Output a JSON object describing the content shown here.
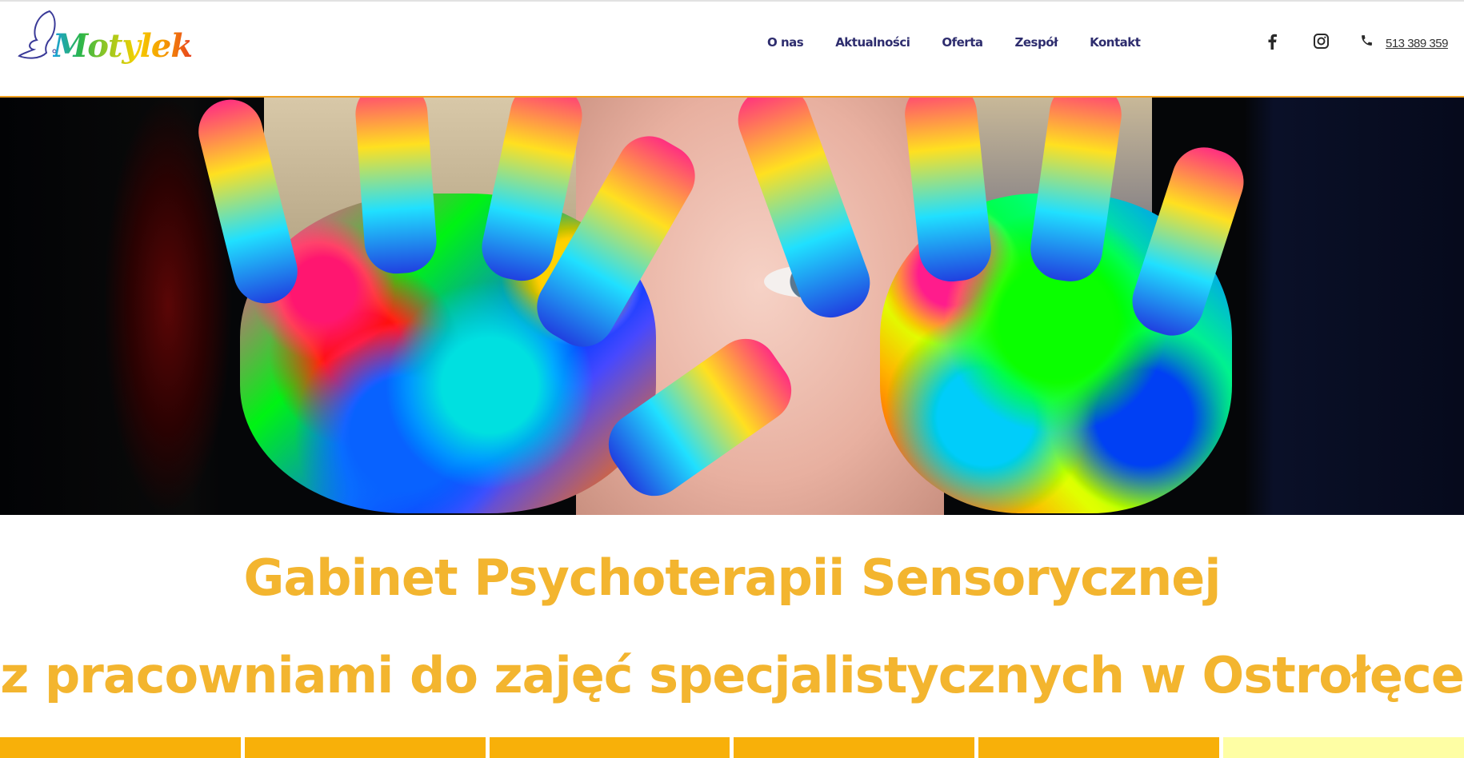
{
  "header": {
    "logo_text": "Motylek",
    "nav": [
      "O nas",
      "Aktualności",
      "Oferta",
      "Zespół",
      "Kontakt"
    ],
    "social": [
      "facebook-icon",
      "instagram-icon"
    ],
    "phone": "513 389 359"
  },
  "main": {
    "title_line1": "Gabinet Psychoterapii Sensorycznej",
    "title_line2": "z pracowniami do zajęć specjalistycznych w Ostrołęce"
  },
  "colors": {
    "accent": "#f3b52f",
    "nav": "#2e2d6e",
    "tile": "#f8b009",
    "tile_last": "#fefea4"
  }
}
